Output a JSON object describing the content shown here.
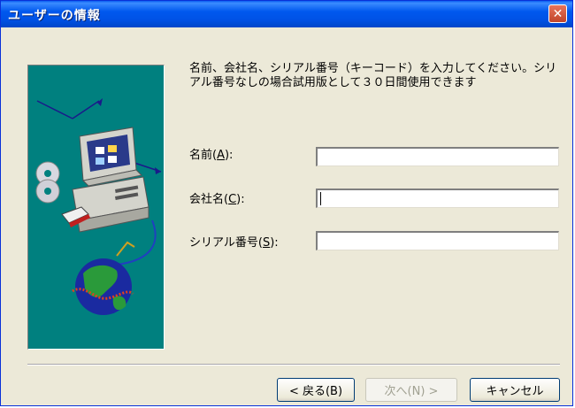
{
  "window": {
    "title": "ユーザーの情報",
    "close_glyph": "✕"
  },
  "instructions": "名前、会社名、シリアル番号（キーコード）を入力してください。シリアル番号なしの場合試用版として３０日間使用できます",
  "form": {
    "name": {
      "label_prefix": "名前(",
      "mnemonic": "A",
      "label_suffix": "):",
      "value": ""
    },
    "company": {
      "label_prefix": "会社名(",
      "mnemonic": "C",
      "label_suffix": "):",
      "value": ""
    },
    "serial": {
      "label_prefix": "シリアル番号(",
      "mnemonic": "S",
      "label_suffix": "):",
      "value": ""
    }
  },
  "buttons": {
    "back": "< 戻る(B)",
    "next": "次へ(N) >",
    "cancel": "キャンセル"
  },
  "colors": {
    "titlebar": "#0055ea",
    "illustration_bg": "#00807f",
    "dialog_bg": "#ece9d8"
  }
}
